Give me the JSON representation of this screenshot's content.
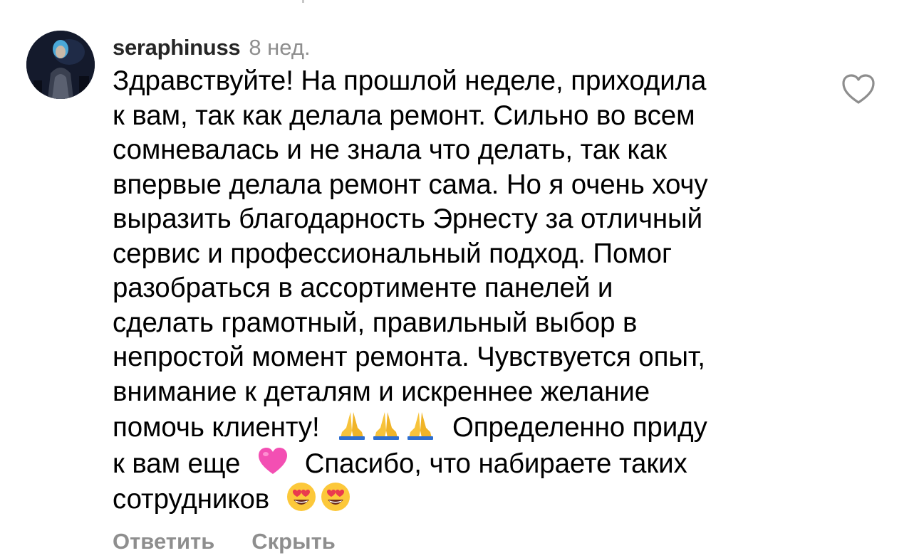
{
  "comment": {
    "username": "seraphinuss",
    "time": "8 нед.",
    "lines": [
      "Здравствуйте! На прошлой неделе, приходила",
      "к вам, так как делала ремонт. Сильно во всем",
      "сомневалась и не знала что делать, так как",
      "впервые делала ремонт сама. Но я очень хочу",
      "выразить благодарность Эрнесту за отличный",
      "сервис и профессиональный подход. Помог",
      "разобраться в ассортименте панелей и",
      "сделать грамотный, правильный выбор в",
      "непростой момент ремонта. Чувствуется опыт,",
      "внимание к деталям и искреннее желание"
    ],
    "line11_start": "помочь клиенту! ",
    "line11_end": " Определенно приду",
    "line12_start": "к вам еще ",
    "line12_end": " Спасибо, что набираете таких",
    "line13_start": "сотрудников ",
    "emojis": [
      "folded-hands",
      "folded-hands",
      "folded-hands",
      "pink-heart",
      "smiling-face-heart-eyes",
      "smiling-face-heart-eyes"
    ]
  },
  "actions": {
    "reply": "Ответить",
    "hide": "Скрыть"
  },
  "colors": {
    "username": "#262626",
    "secondary": "#8e8e8e",
    "text": "#000000"
  },
  "icons": {
    "like": "heart-outline-icon",
    "avatar": "user-avatar"
  }
}
